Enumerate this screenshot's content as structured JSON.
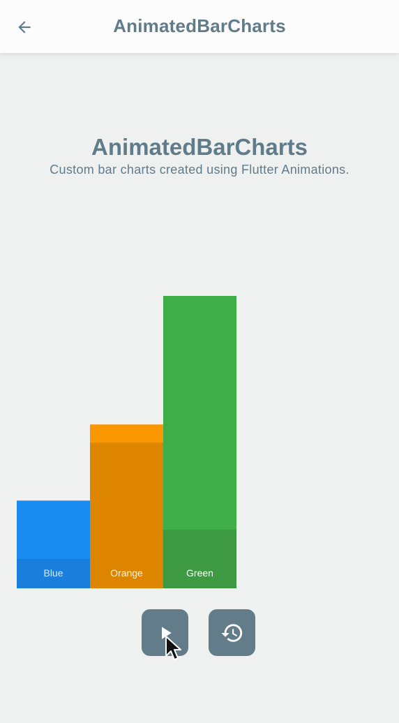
{
  "appbar": {
    "title": "AnimatedBarCharts",
    "back_icon": "arrow-back-icon"
  },
  "header": {
    "title": "AnimatedBarCharts",
    "subtitle": "Custom bar charts created using Flutter Animations."
  },
  "chart_data": {
    "type": "bar",
    "categories": [
      "Blue",
      "Orange",
      "Green"
    ],
    "values": [
      30,
      56,
      100
    ],
    "ylim": [
      0,
      100
    ],
    "colors": {
      "Blue": {
        "bar": "#1a8cf0",
        "label_band": "#1a7fdc",
        "label_text": "#dbe9f7"
      },
      "Orange": {
        "bar": "#de8500",
        "top_band": "#fb9700",
        "label_band": "#de8500",
        "label_text": "#fdf4e6"
      },
      "Green": {
        "bar": "#3fae48",
        "label_band": "#3d9a43",
        "label_text": "#ffffff"
      }
    },
    "grid": false,
    "legend": "none"
  },
  "controls": {
    "play_icon": "play-icon",
    "replay_icon": "history-icon",
    "button_color": "#637c8a"
  },
  "colors": {
    "background": "#eef1ef",
    "appbar": "#fbfcfb",
    "text": "#607b8a"
  }
}
